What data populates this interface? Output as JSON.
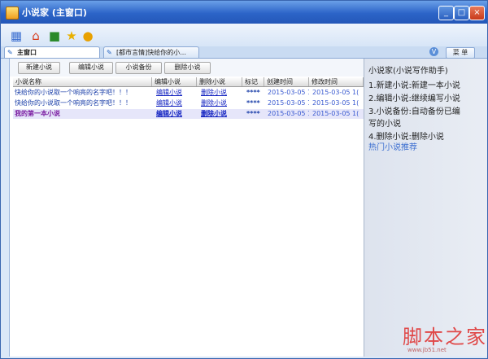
{
  "window": {
    "title": "小说家 (主窗口)",
    "controls": [
      "_",
      "□",
      "×"
    ]
  },
  "toolbar": {
    "icons": [
      "window-icon",
      "home-icon",
      "book-icon",
      "star-icon",
      "chat-icon"
    ]
  },
  "tabs": [
    {
      "label": "主窗口",
      "active": true
    },
    {
      "label": "[都市言情]快给你的小..."
    }
  ],
  "tabbar": {
    "circle_label": "V",
    "menu_label": "菜 单"
  },
  "buttons": [
    "新建小说",
    "编辑小说",
    "小说备份",
    "删除小说"
  ],
  "table": {
    "columns": [
      "小说名称",
      "编辑小说",
      "删除小说",
      "标记",
      "创建时间",
      "修改时间"
    ],
    "rows": [
      {
        "name": "快给你的小说取一个响亮的名字吧！！！",
        "edit": "编辑小说",
        "del": "删除小说",
        "mark": "****",
        "created": "2015-03-05  1(",
        "modified": "2015-03-05  1("
      },
      {
        "name": "快给你的小说取一个响亮的名字吧！！！",
        "edit": "编辑小说",
        "del": "删除小说",
        "mark": "****",
        "created": "2015-03-05  1(",
        "modified": "2015-03-05  1("
      },
      {
        "name": "我的第一本小说",
        "edit": "编辑小说",
        "del": "删除小说",
        "mark": "****",
        "created": "2015-03-05  1(",
        "modified": "2015-03-05  1(",
        "selected": true
      }
    ]
  },
  "sidebar": {
    "title": "小说家(小说写作助手)",
    "lines": [
      "1.新建小说:新建一本小说",
      "2.编辑小说:继续编写小说",
      "3.小说备份:自动备份已编",
      "写的小说",
      "4.删除小说:删除小说"
    ],
    "link": "热门小说推荐"
  },
  "watermark": {
    "text": "脚本之家",
    "sub": "www.jb51.net"
  }
}
